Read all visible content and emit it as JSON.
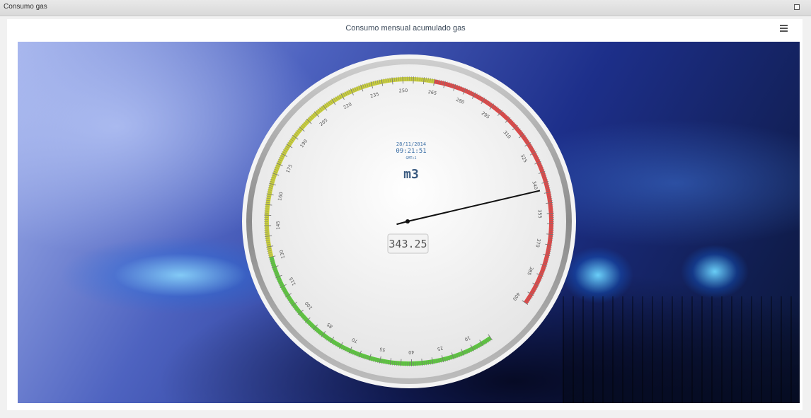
{
  "window": {
    "title": "Consumo gas"
  },
  "chart": {
    "title": "Consumo mensual acumulado gas"
  },
  "chart_data": {
    "type": "gauge",
    "min": 0,
    "max": 400,
    "value": 343.25,
    "value_display": "343.25",
    "unit": "m3",
    "date": "28/11/2014",
    "time": "09:21:51",
    "timezone": "GMT+1",
    "tick_labels": [
      "10",
      "25",
      "40",
      "55",
      "70",
      "85",
      "100",
      "115",
      "130",
      "145",
      "160",
      "175",
      "190",
      "205",
      "220",
      "235",
      "250",
      "265",
      "280",
      "295",
      "310",
      "325",
      "340",
      "355",
      "370",
      "385",
      "400"
    ],
    "bands": [
      {
        "from": 0,
        "to": 130,
        "color": "#5cc93d"
      },
      {
        "from": 130,
        "to": 265,
        "color": "#c9cf3a"
      },
      {
        "from": 265,
        "to": 400,
        "color": "#e04646"
      }
    ]
  }
}
